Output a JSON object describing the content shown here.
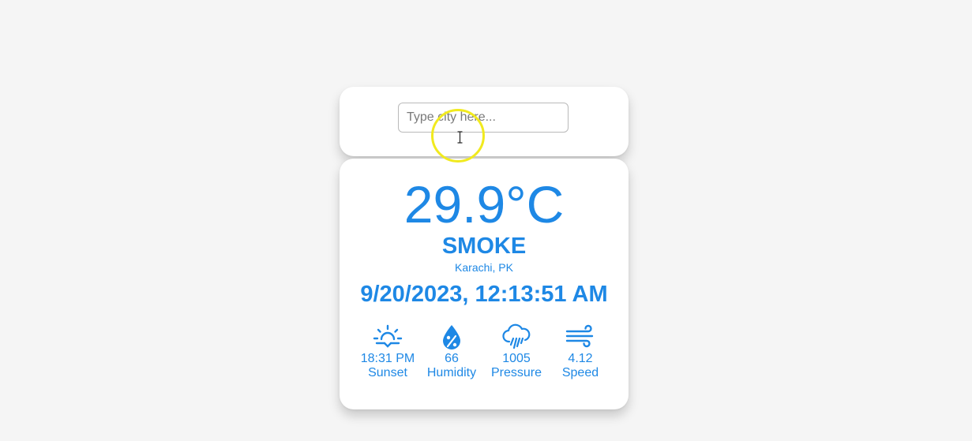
{
  "search": {
    "placeholder": "Type city here..."
  },
  "weather": {
    "temperature": "29.9°C",
    "condition": "SMOKE",
    "location": "Karachi, PK",
    "datetime": "9/20/2023, 12:13:51 AM"
  },
  "stats": [
    {
      "icon": "sunset-icon",
      "value": "18:31 PM",
      "label": "Sunset"
    },
    {
      "icon": "humidity-icon",
      "value": "66",
      "label": "Humidity"
    },
    {
      "icon": "pressure-icon",
      "value": "1005",
      "label": "Pressure"
    },
    {
      "icon": "wind-icon",
      "value": "4.12",
      "label": "Speed"
    }
  ],
  "colors": {
    "accent": "#1e88e5",
    "background": "#f5f5f5",
    "card": "#ffffff",
    "cursor_highlight": "#f1ea1f"
  }
}
